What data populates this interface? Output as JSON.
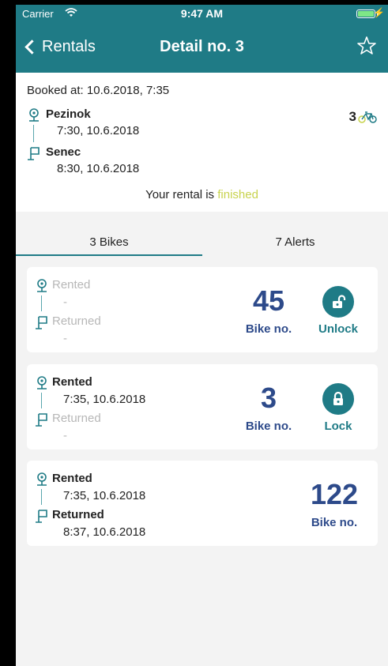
{
  "status_bar": {
    "carrier": "Carrier",
    "time": "9:47 AM",
    "wifi_icon": "wifi-icon",
    "battery_icon": "battery-icon"
  },
  "nav": {
    "back_label": "Rentals",
    "title": "Detail no. 3",
    "favorite_icon": "star-icon"
  },
  "booking": {
    "booked_at": "Booked at: 10.6.2018, 7:35",
    "from_name": "Pezinok",
    "from_time": "7:30, 10.6.2018",
    "to_name": "Senec",
    "to_time": "8:30, 10.6.2018",
    "bike_count": "3",
    "status_prefix": "Your rental is ",
    "status_value": "finished"
  },
  "tabs": [
    {
      "label": "3 Bikes",
      "active": true
    },
    {
      "label": "7 Alerts",
      "active": false
    }
  ],
  "bikes": [
    {
      "rented_label": "Rented",
      "rented_time": "-",
      "returned_label": "Returned",
      "returned_time": "-",
      "number": "45",
      "number_caption": "Bike no.",
      "action_label": "Unlock",
      "action_icon": "unlock-icon"
    },
    {
      "rented_label": "Rented",
      "rented_time": "7:35, 10.6.2018",
      "returned_label": "Returned",
      "returned_time": "-",
      "number": "3",
      "number_caption": "Bike no.",
      "action_label": "Lock",
      "action_icon": "lock-icon"
    },
    {
      "rented_label": "Rented",
      "rented_time": "7:35, 10.6.2018",
      "returned_label": "Returned",
      "returned_time": "8:37, 10.6.2018",
      "number": "122",
      "number_caption": "Bike no."
    }
  ],
  "colors": {
    "accent": "#1f7b86",
    "bike_number": "#2d4a8a",
    "finished": "#c8d34d",
    "inactive_text": "#b7b7b7"
  }
}
